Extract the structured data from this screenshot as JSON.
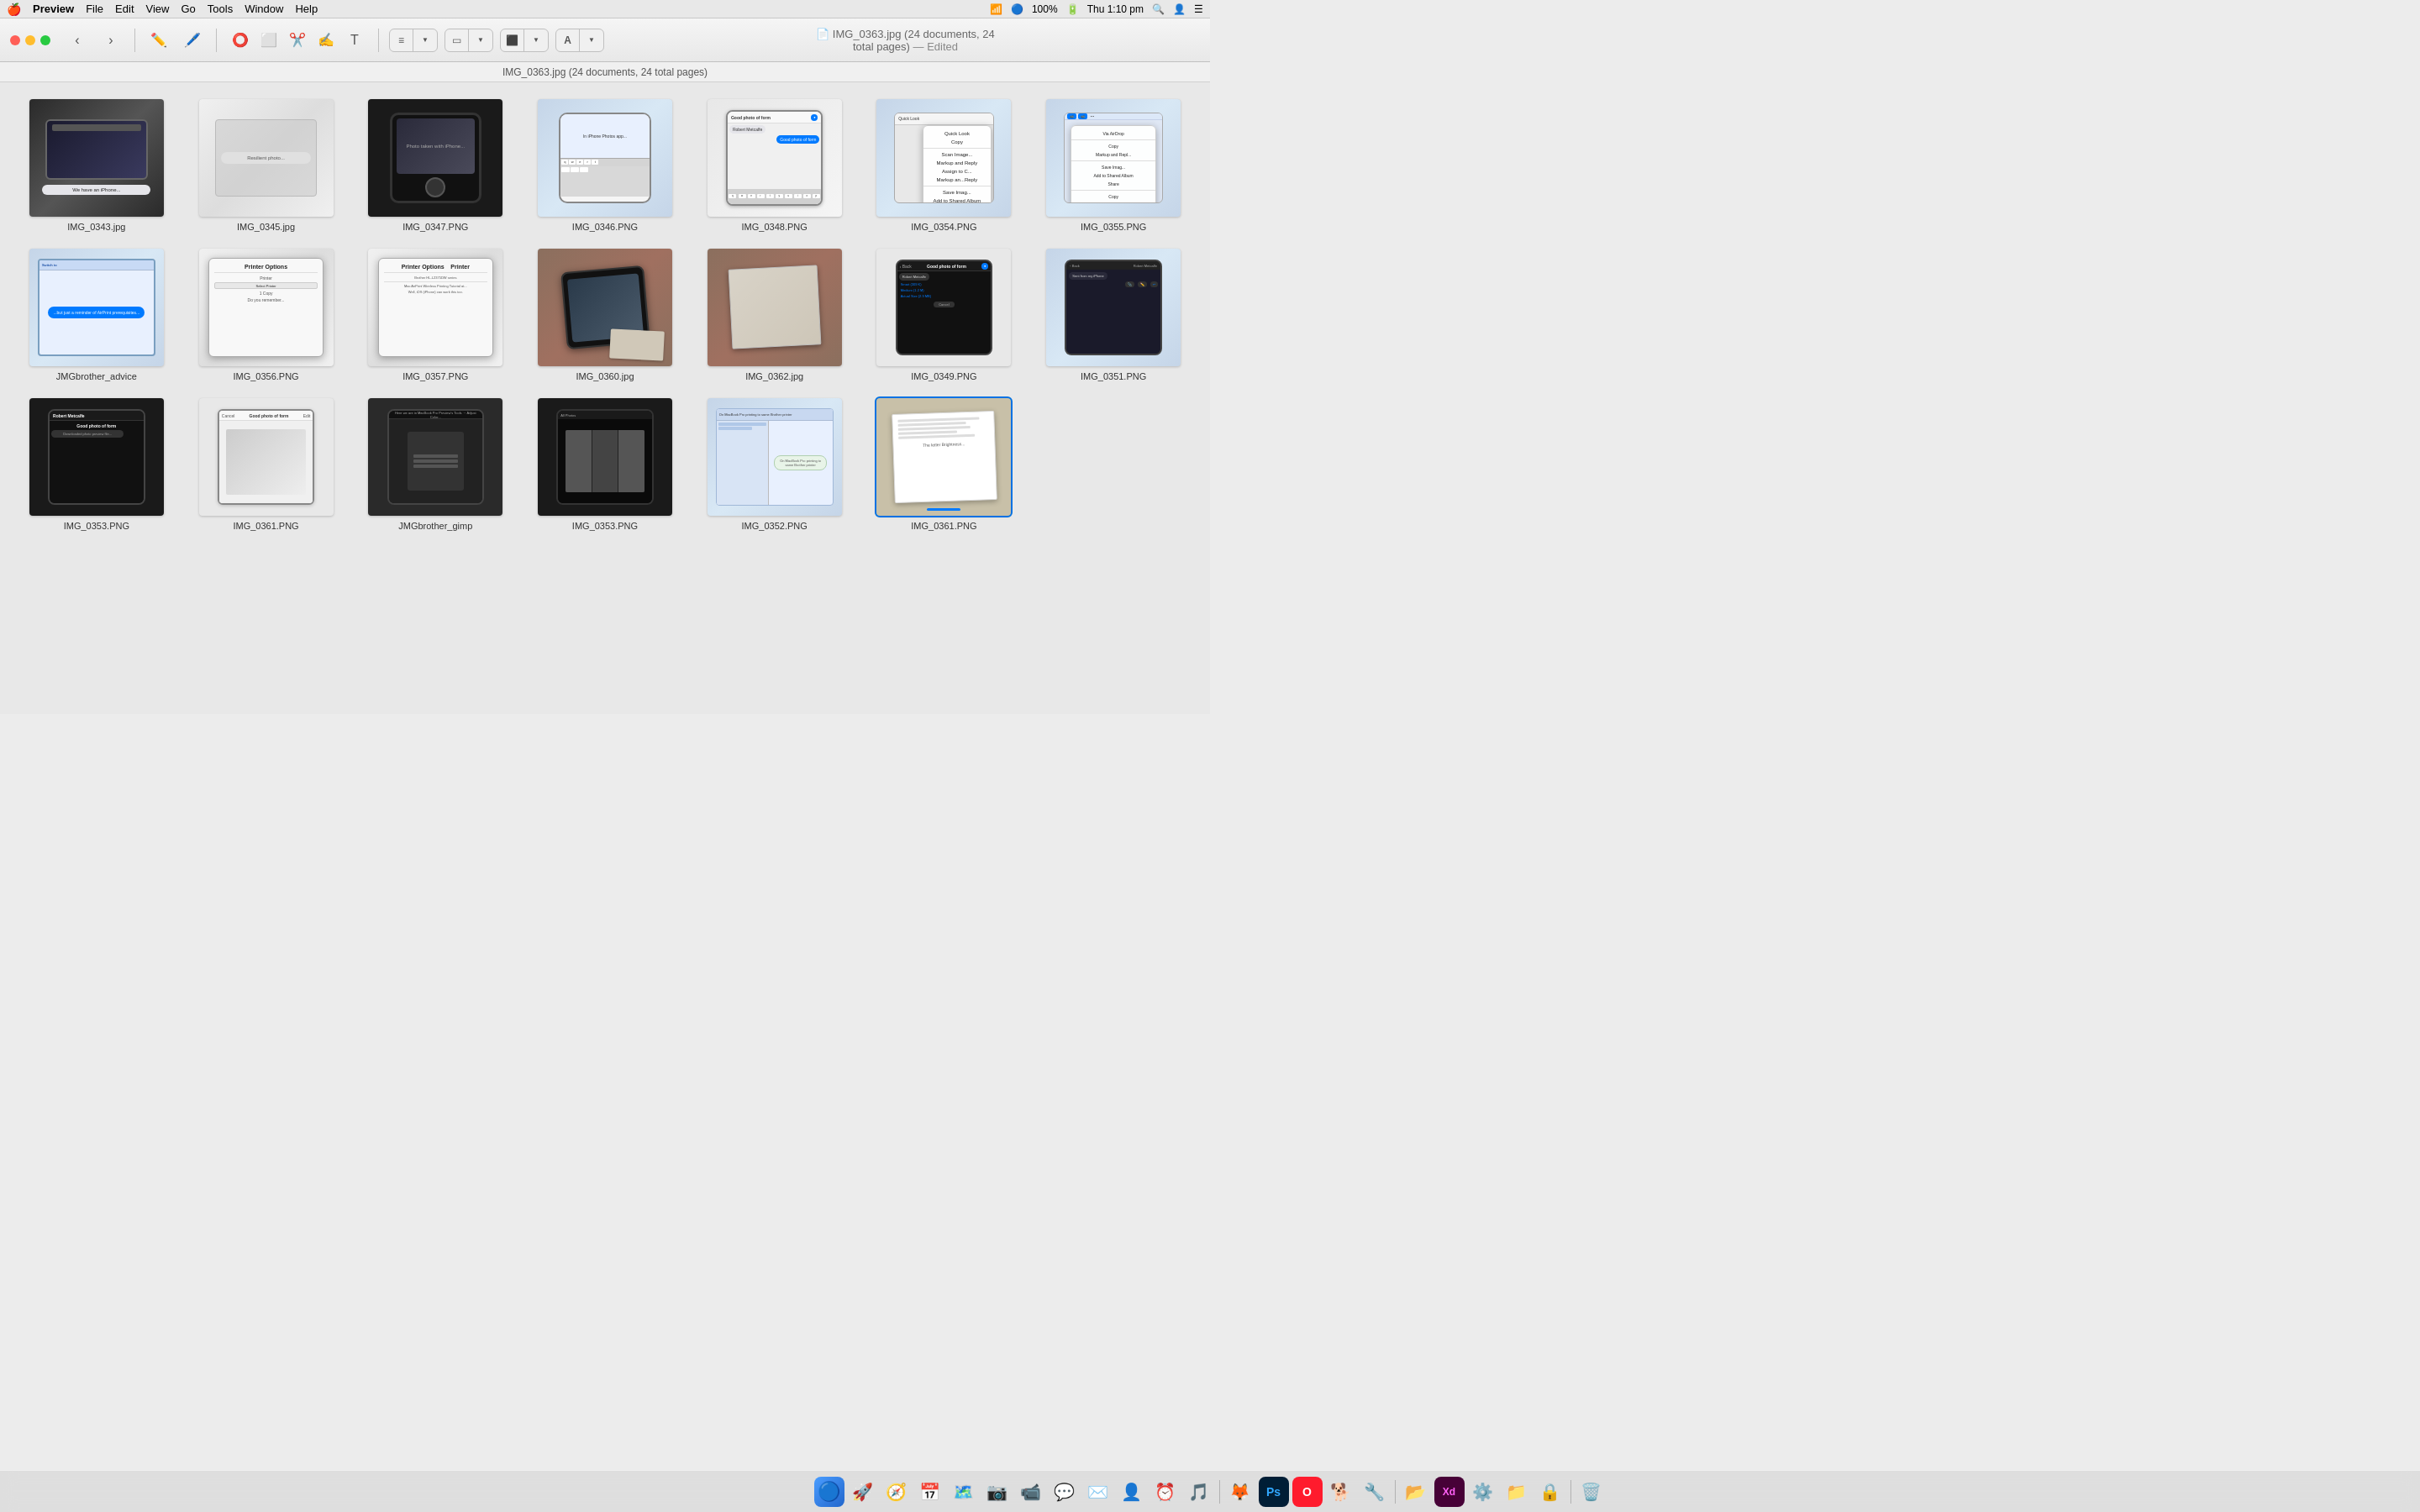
{
  "menubar": {
    "apple": "🍎",
    "app_name": "Preview",
    "menus": [
      "File",
      "Edit",
      "View",
      "Go",
      "Tools",
      "Window",
      "Help"
    ],
    "right_items": {
      "battery": "100%",
      "time": "Thu 1:10 pm",
      "wifi": "WiFi"
    }
  },
  "window": {
    "title": "IMG_0363.jpg (24 documents, 24 total pages)",
    "subtitle": "— Edited",
    "path_bar": "IMG_0363.jpg (24 documents, 24 total pages)"
  },
  "thumbnails": [
    {
      "id": "img-0343",
      "filename": "IMG_0343.jpg",
      "type": "dark_photo",
      "description": "Dark photo with chat bubble"
    },
    {
      "id": "img-0345",
      "filename": "IMG_0345.jpg",
      "type": "white_blur",
      "description": "White blurry photo"
    },
    {
      "id": "img-0347",
      "filename": "IMG_0347.PNG",
      "type": "iphone_dark",
      "description": "iPhone dark screen with photo"
    },
    {
      "id": "img-0346",
      "filename": "IMG_0346.PNG",
      "type": "iphone_blue",
      "description": "iPhone blue screen"
    },
    {
      "id": "img-0348",
      "filename": "IMG_0348.PNG",
      "type": "good_photo_form",
      "description": "Good photo of form"
    },
    {
      "id": "img-0354",
      "filename": "IMG_0354.PNG",
      "type": "context_menu",
      "description": "Context menu screenshot"
    },
    {
      "id": "img-0355",
      "filename": "IMG_0355.PNG",
      "type": "context_menu2",
      "description": "Context menu 2"
    },
    {
      "id": "jmg-brother-advice",
      "filename": "JMGbrother_advice",
      "type": "ipad_blue",
      "description": "iPad blue advice"
    },
    {
      "id": "img-0356",
      "filename": "IMG_0356.PNG",
      "type": "printer_dialog",
      "description": "Printer dialog"
    },
    {
      "id": "img-0357",
      "filename": "IMG_0357.PNG",
      "type": "printer_dialog2",
      "description": "Printer options"
    },
    {
      "id": "img-0360",
      "filename": "IMG_0360.jpg",
      "type": "printer_photo",
      "description": "Printer photo"
    },
    {
      "id": "img-0362",
      "filename": "IMG_0362.jpg",
      "type": "printer_paper",
      "description": "Photo of printer paper"
    },
    {
      "id": "img-0349",
      "filename": "IMG_0349.PNG",
      "type": "good_photo_form2",
      "description": "Good photo of form 2"
    },
    {
      "id": "img-0351",
      "filename": "IMG_0351.PNG",
      "type": "iphone_screen2",
      "description": "iPhone screen 2"
    },
    {
      "id": "img-0353-top",
      "filename": "IMG_0353.PNG",
      "type": "iphone_messages",
      "description": "iPhone messages"
    },
    {
      "id": "img-0361",
      "filename": "IMG_0361.PNG",
      "type": "good_photo_form3",
      "description": "Good photo of form 3"
    },
    {
      "id": "jmg-brother-gimp",
      "filename": "JMGbrother_gimp",
      "type": "iphone_gimp",
      "description": "iPhone gimp screen"
    },
    {
      "id": "img-0353-bot",
      "filename": "IMG_0353.PNG",
      "type": "iphone_dark2",
      "description": "iPhone dark 2"
    },
    {
      "id": "img-0352",
      "filename": "IMG_0352.PNG",
      "type": "macbook_brother",
      "description": "MacBook brother printer"
    },
    {
      "id": "img-0361-last",
      "filename": "IMG_0361.PNG",
      "type": "paper_photo",
      "description": "Paper photo selected",
      "selected": true
    }
  ],
  "dock": {
    "icons": [
      {
        "name": "finder",
        "emoji": "🔵",
        "label": "Finder"
      },
      {
        "name": "launchpad",
        "emoji": "🚀",
        "label": "Launchpad"
      },
      {
        "name": "safari",
        "emoji": "🧭",
        "label": "Safari"
      },
      {
        "name": "calendar",
        "emoji": "📅",
        "label": "Calendar"
      },
      {
        "name": "maps",
        "emoji": "🗺️",
        "label": "Maps"
      },
      {
        "name": "photos",
        "emoji": "📷",
        "label": "Photos"
      },
      {
        "name": "facetime",
        "emoji": "📹",
        "label": "FaceTime"
      },
      {
        "name": "messages",
        "emoji": "💬",
        "label": "Messages"
      },
      {
        "name": "mail",
        "emoji": "✉️",
        "label": "Mail"
      },
      {
        "name": "contacts",
        "emoji": "👤",
        "label": "Contacts"
      },
      {
        "name": "reminders",
        "emoji": "⏰",
        "label": "Reminders"
      },
      {
        "name": "music",
        "emoji": "🎵",
        "label": "Music"
      },
      {
        "name": "firefox",
        "emoji": "🦊",
        "label": "Firefox"
      },
      {
        "name": "ps",
        "emoji": "🎨",
        "label": "Photoshop"
      },
      {
        "name": "opera",
        "emoji": "⭕",
        "label": "Opera"
      },
      {
        "name": "gimp",
        "emoji": "🐕",
        "label": "GIMP"
      },
      {
        "name": "tools",
        "emoji": "🔧",
        "label": "Tools"
      }
    ]
  }
}
